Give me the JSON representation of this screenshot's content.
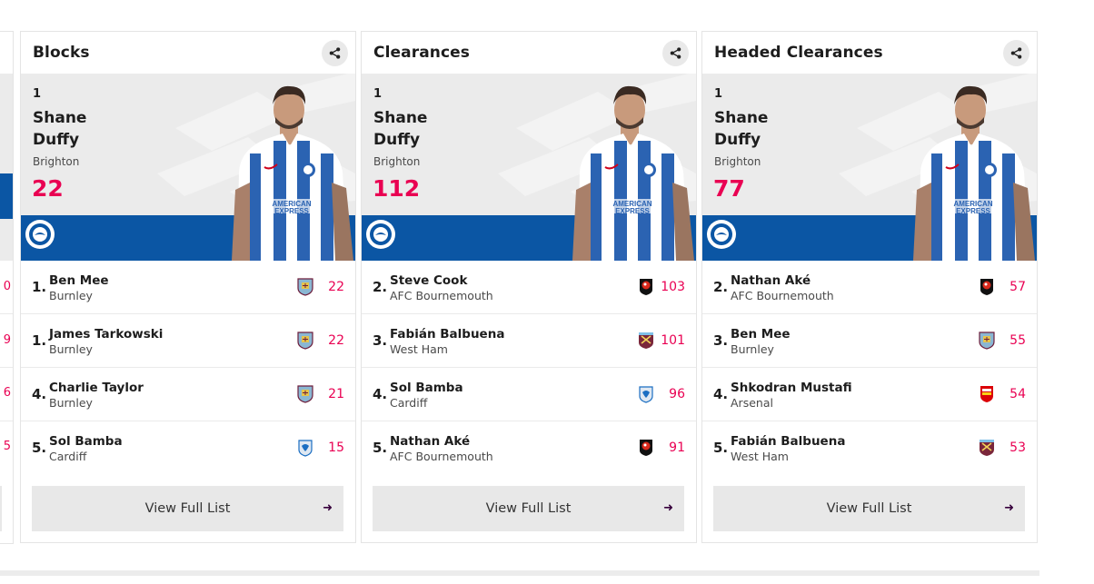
{
  "partial_card": {
    "values": [
      "0",
      "9",
      "6",
      "5"
    ]
  },
  "cards": [
    {
      "title": "Blocks",
      "leader": {
        "rank": "1",
        "first_name": "Shane",
        "last_name": "Duffy",
        "club": "Brighton",
        "value": "22"
      },
      "rows": [
        {
          "pos": "1.",
          "name": "Ben Mee",
          "club": "Burnley",
          "value": "22",
          "crest": "burnley-crest-icon"
        },
        {
          "pos": "1.",
          "name": "James Tarkowski",
          "club": "Burnley",
          "value": "22",
          "crest": "burnley-crest-icon"
        },
        {
          "pos": "4.",
          "name": "Charlie Taylor",
          "club": "Burnley",
          "value": "21",
          "crest": "burnley-crest-icon"
        },
        {
          "pos": "5.",
          "name": "Sol Bamba",
          "club": "Cardiff",
          "value": "15",
          "crest": "cardiff-crest-icon"
        }
      ],
      "button": "View Full List"
    },
    {
      "title": "Clearances",
      "leader": {
        "rank": "1",
        "first_name": "Shane",
        "last_name": "Duffy",
        "club": "Brighton",
        "value": "112"
      },
      "rows": [
        {
          "pos": "2.",
          "name": "Steve Cook",
          "club": "AFC Bournemouth",
          "value": "103",
          "crest": "bournemouth-crest-icon"
        },
        {
          "pos": "3.",
          "name": "Fabián Balbuena",
          "club": "West Ham",
          "value": "101",
          "crest": "westham-crest-icon"
        },
        {
          "pos": "4.",
          "name": "Sol Bamba",
          "club": "Cardiff",
          "value": "96",
          "crest": "cardiff-crest-icon"
        },
        {
          "pos": "5.",
          "name": "Nathan Aké",
          "club": "AFC Bournemouth",
          "value": "91",
          "crest": "bournemouth-crest-icon"
        }
      ],
      "button": "View Full List"
    },
    {
      "title": "Headed Clearances",
      "leader": {
        "rank": "1",
        "first_name": "Shane",
        "last_name": "Duffy",
        "club": "Brighton",
        "value": "77"
      },
      "rows": [
        {
          "pos": "2.",
          "name": "Nathan Aké",
          "club": "AFC Bournemouth",
          "value": "57",
          "crest": "bournemouth-crest-icon"
        },
        {
          "pos": "3.",
          "name": "Ben Mee",
          "club": "Burnley",
          "value": "55",
          "crest": "burnley-crest-icon"
        },
        {
          "pos": "4.",
          "name": "Shkodran Mustafi",
          "club": "Arsenal",
          "value": "54",
          "crest": "arsenal-crest-icon"
        },
        {
          "pos": "5.",
          "name": "Fabián Balbuena",
          "club": "West Ham",
          "value": "53",
          "crest": "westham-crest-icon"
        }
      ],
      "button": "View Full List"
    }
  ],
  "colors": {
    "accent": "#e90052",
    "band": "#0b56a4",
    "hero_bg": "#ebebeb",
    "button_bg": "#e8e8e8"
  }
}
